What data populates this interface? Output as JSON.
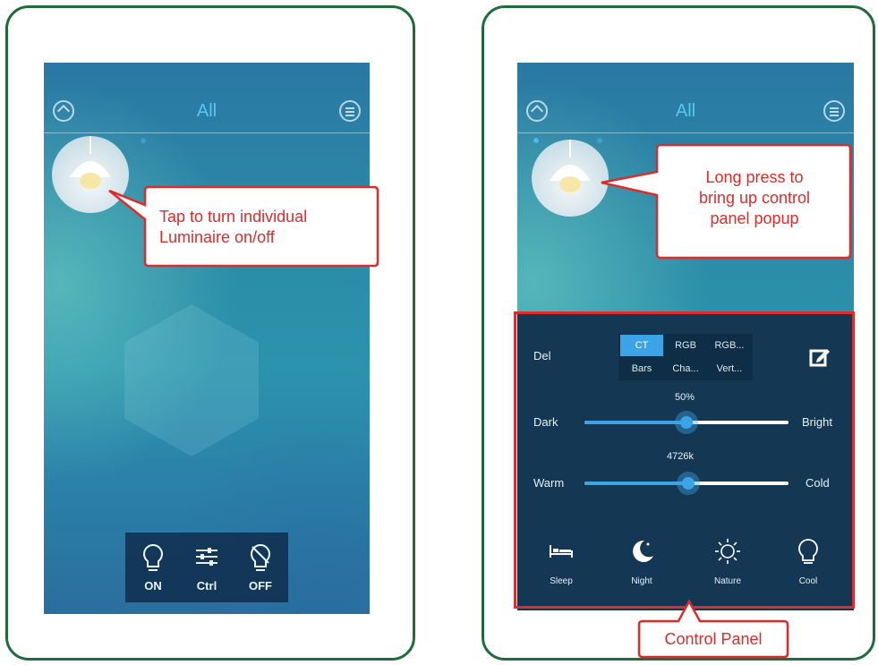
{
  "left_screen": {
    "title": "All",
    "callout": [
      "Tap to turn individual",
      "Luminaire on/off"
    ],
    "bottom_bar": {
      "on_label": "ON",
      "ctrl_label": "Ctrl",
      "off_label": "OFF"
    }
  },
  "right_screen": {
    "title": "All",
    "callout": [
      "Long press to",
      "bring up control",
      "panel popup"
    ],
    "panel": {
      "del_label": "Del",
      "tabs": [
        [
          "CT",
          "RGB",
          "RGB..."
        ],
        [
          "Bars",
          "Cha...",
          "Vert..."
        ]
      ],
      "selected_tab": "CT",
      "brightness": {
        "value_label": "50%",
        "min_label": "Dark",
        "max_label": "Bright",
        "fraction": 0.5
      },
      "temperature": {
        "value_label": "4726k",
        "min_label": "Warm",
        "max_label": "Cold",
        "fraction": 0.51
      },
      "scenes": [
        {
          "label": "Sleep",
          "icon": "bed-icon"
        },
        {
          "label": "Night",
          "icon": "moon-icon"
        },
        {
          "label": "Nature",
          "icon": "sun-icon"
        },
        {
          "label": "Cool",
          "icon": "bulb-icon"
        }
      ]
    },
    "panel_callout": "Control Panel"
  },
  "colors": {
    "frame": "#1f6b3a",
    "callout": "#e02b2b",
    "accent": "#3ba4e6",
    "title": "#55c8f2"
  }
}
